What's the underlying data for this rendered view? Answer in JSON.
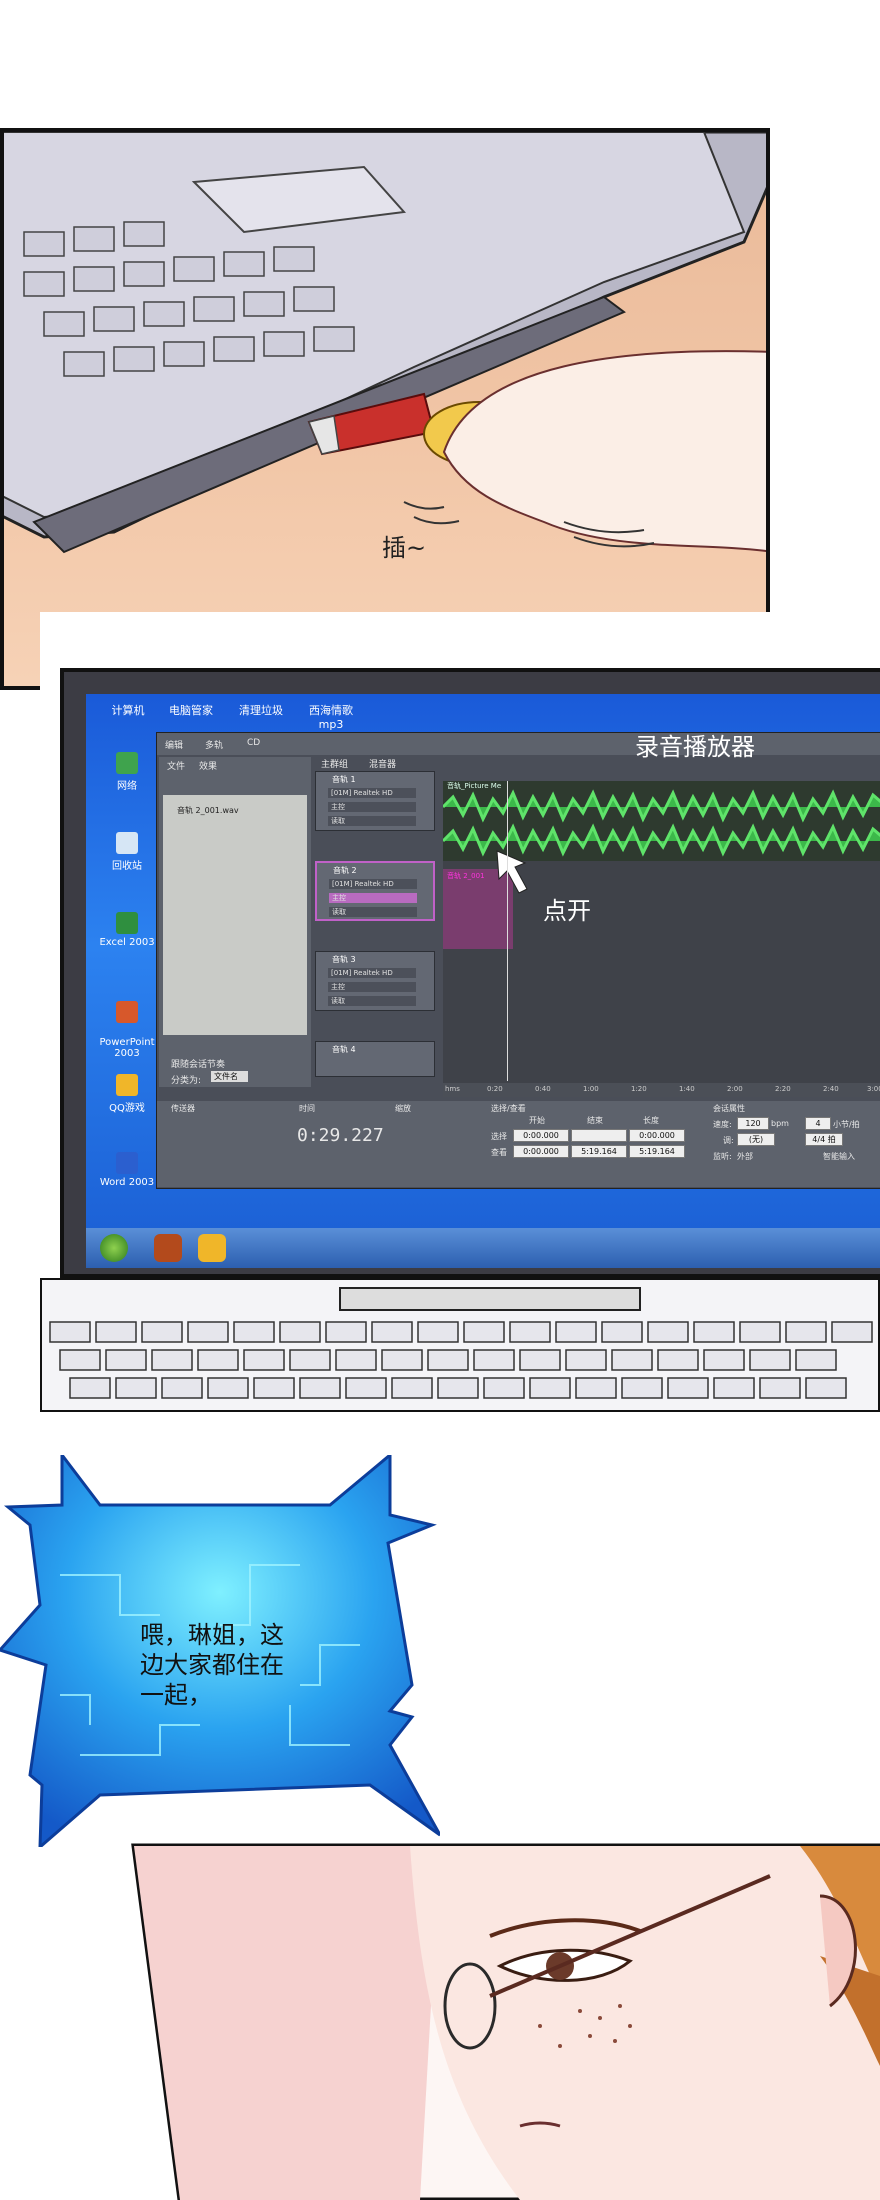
{
  "panel1": {
    "sfx": "插~"
  },
  "desktop": {
    "top_icons": [
      "计算机",
      "电脑管家",
      "清理垃圾",
      "西海情歌\nmp3"
    ],
    "side_icons": [
      {
        "label": "网络",
        "icon": "network-icon"
      },
      {
        "label": "回收站",
        "icon": "recycle-bin-icon"
      },
      {
        "label": "Excel 2003",
        "icon": "excel-icon"
      },
      {
        "label": "PowerPoint\n2003",
        "icon": "powerpoint-icon"
      },
      {
        "label": "QQ游戏",
        "icon": "qq-game-icon"
      },
      {
        "label": "Word 2003",
        "icon": "word-icon"
      }
    ]
  },
  "app": {
    "overlay_title": "录音播放器",
    "mode_tabs": [
      "编辑",
      "多轨",
      "CD"
    ],
    "panel_tabs": [
      "文件",
      "效果"
    ],
    "view_tabs": [
      "主群组",
      "混音器"
    ],
    "file_item": "音轨 2_001.wav",
    "follow_session": "跟随会话节奏",
    "sort_label": "分类为:",
    "sort_value": "文件名",
    "wave_clip_label": "音轨_Picture Me",
    "clip2_label": "音轨 2_001",
    "tracks": [
      {
        "name": "音轨 1",
        "device": "[01M] Realtek HD",
        "out": "主控",
        "mode": "读取"
      },
      {
        "name": "音轨 2",
        "device": "[01M] Realtek HD",
        "out": "主控",
        "mode": "读取"
      },
      {
        "name": "音轨 3",
        "device": "[01M] Realtek HD",
        "out": "主控",
        "mode": "读取"
      },
      {
        "name": "音轨 4",
        "device": "",
        "out": "",
        "mode": ""
      }
    ],
    "ruler": [
      "hms",
      "0:20",
      "0:40",
      "1:00",
      "1:20",
      "1:40",
      "2:00",
      "2:20",
      "2:40",
      "3:00"
    ],
    "transport_tab": "传送器",
    "time_tab": "时间",
    "time_value": "0:29.227",
    "zoom_tab": "缩放",
    "selection_tab": "选择/查看",
    "selection": {
      "col_start": "开始",
      "col_end": "结束",
      "col_len": "长度",
      "row_select": "选择",
      "row_view": "查看",
      "select_start": "0:00.000",
      "select_end": "",
      "select_len": "0:00.000",
      "view_start": "0:00.000",
      "view_end": "5:19.164",
      "view_len": "5:19.164"
    },
    "session_tab": "会话属性",
    "session": {
      "speed_label": "速度:",
      "speed": "120",
      "bpm": "bpm",
      "beats": "4",
      "beats_label": "小节/拍",
      "key_label": "调:",
      "key": "(无)",
      "meter": "4/4 拍",
      "monitor_label": "监听:",
      "monitor": "外部",
      "smart": "智能输入"
    },
    "annotation": "点开"
  },
  "speech": {
    "text": "喂，琳姐，这\n边大家都住在\n一起，"
  }
}
